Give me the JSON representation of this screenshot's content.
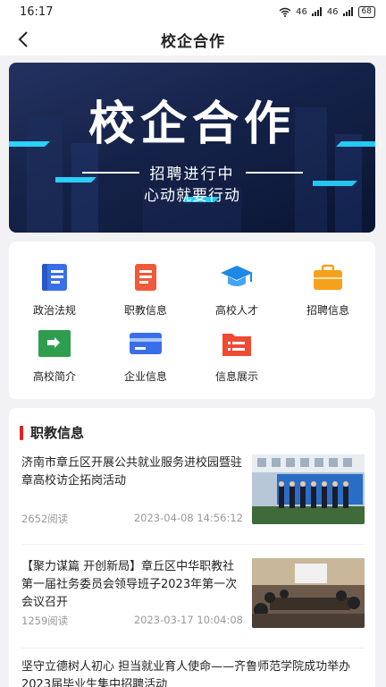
{
  "status_bar": {
    "time": "16:17",
    "signal": "46",
    "signal2": "46",
    "battery": "68"
  },
  "nav": {
    "title": "校企合作"
  },
  "banner": {
    "title": "校企合作",
    "subtitle": "招聘进行中",
    "tagline": "心动就要行动"
  },
  "menu": [
    {
      "label": "政治法规",
      "icon": "book-icon",
      "color": "#3a6ee8"
    },
    {
      "label": "职教信息",
      "icon": "document-icon",
      "color": "#f05a3a"
    },
    {
      "label": "高校人才",
      "icon": "graduation-cap-icon",
      "color": "#1e88e5"
    },
    {
      "label": "招聘信息",
      "icon": "briefcase-icon",
      "color": "#f5a21b"
    },
    {
      "label": "高校简介",
      "icon": "folder-icon",
      "color": "#2e9e4e"
    },
    {
      "label": "企业信息",
      "icon": "card-icon",
      "color": "#3a6ee8"
    },
    {
      "label": "信息展示",
      "icon": "list-folder-icon",
      "color": "#f04a32"
    }
  ],
  "section": {
    "title": "职教信息"
  },
  "news": [
    {
      "title": "济南市章丘区开展公共就业服务进校园暨驻章高校访企拓岗活动",
      "reads": "2652阅读",
      "date": "2023-04-08 14:56:12"
    },
    {
      "title": "【聚力谋篇 开创新局】章丘区中华职教社第一届社务委员会领导班子2023年第一次会议召开",
      "reads": "1259阅读",
      "date": "2023-03-17 10:04:08"
    },
    {
      "title": "坚守立德树人初心 担当就业育人使命——齐鲁师范学院成功举办2023届毕业生集中招聘活动"
    }
  ]
}
